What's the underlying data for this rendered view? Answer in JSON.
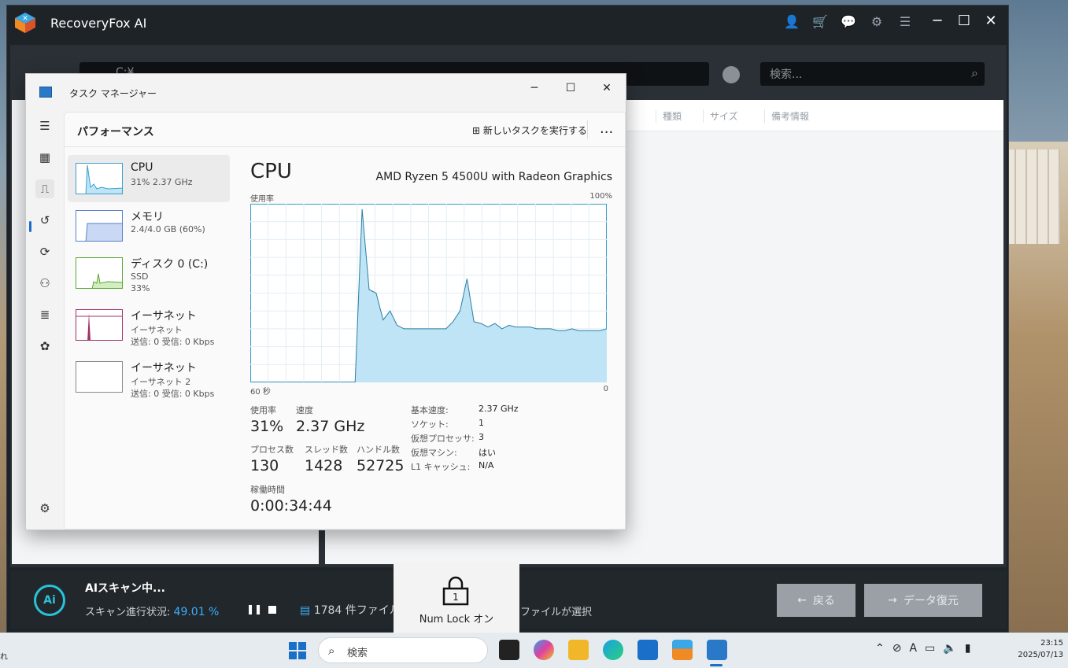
{
  "recoveryfox": {
    "title": "RecoveryFox AI",
    "path": "C:¥",
    "search_placeholder": "検索...",
    "columns": [
      "種類",
      "サイズ",
      "備考情報"
    ],
    "scan": {
      "title": "AIスキャン中...",
      "status_label": "スキャン進行状況:",
      "percent": "49.01 %",
      "files_text": "1784 件ファイル",
      "selected_text": "ファイルが選択"
    },
    "buttons": {
      "back": "戻る",
      "recover": "データ復元"
    },
    "ai_badge": "Ai"
  },
  "task_manager": {
    "title": "タスク マネージャー",
    "page_title": "パフォーマンス",
    "run_new_task": "新しいタスクを実行する",
    "more": "...",
    "perf_items": [
      {
        "name": "CPU",
        "sub1": "31%  2.37 GHz",
        "sub2": ""
      },
      {
        "name": "メモリ",
        "sub1": "2.4/4.0 GB (60%)",
        "sub2": ""
      },
      {
        "name": "ディスク 0 (C:)",
        "sub1": "SSD",
        "sub2": "33%"
      },
      {
        "name": "イーサネット",
        "sub1": "イーサネット",
        "sub2": "送信: 0 受信: 0 Kbps"
      },
      {
        "name": "イーサネット",
        "sub1": "イーサネット 2",
        "sub2": "送信: 0 受信: 0 Kbps"
      }
    ],
    "detail": {
      "title": "CPU",
      "model": "AMD Ryzen 5 4500U with Radeon Graphics",
      "y_label": "使用率",
      "y_max": "100%",
      "x_left": "60 秒",
      "x_right": "0",
      "stats": {
        "usage_label": "使用率",
        "usage": "31%",
        "speed_label": "速度",
        "speed": "2.37 GHz",
        "proc_label": "プロセス数",
        "proc": "130",
        "thread_label": "スレッド数",
        "thread": "1428",
        "handle_label": "ハンドル数",
        "handle": "52725",
        "uptime_label": "稼働時間",
        "uptime": "0:00:34:44"
      },
      "info": [
        {
          "k": "基本速度:",
          "v": "2.37 GHz"
        },
        {
          "k": "ソケット:",
          "v": "1"
        },
        {
          "k": "仮想プロセッサ:",
          "v": "3"
        },
        {
          "k": "仮想マシン:",
          "v": "はい"
        },
        {
          "k": "L1 キャッシュ:",
          "v": "N/A"
        }
      ]
    }
  },
  "chart_data": {
    "type": "area",
    "y_range": [
      0,
      100
    ],
    "x_range_seconds": [
      60,
      0
    ],
    "values": [
      0,
      0,
      0,
      0,
      0,
      0,
      0,
      0,
      0,
      0,
      0,
      0,
      0,
      0,
      0,
      0,
      97,
      52,
      50,
      35,
      40,
      32,
      30,
      30,
      30,
      30,
      30,
      30,
      30,
      34,
      40,
      58,
      34,
      33,
      31,
      33,
      30,
      32,
      31,
      31,
      31,
      30,
      30,
      30,
      29,
      29,
      30,
      29,
      29,
      29,
      29,
      30
    ],
    "grid": true,
    "color": "#7cc4e6"
  },
  "numlock": {
    "digit": "1",
    "label": "Num Lock オン"
  },
  "taskbar": {
    "left_text": "れ",
    "search_placeholder": "検索",
    "time": "23:15",
    "date": "2025/07/13",
    "ime": "A"
  }
}
